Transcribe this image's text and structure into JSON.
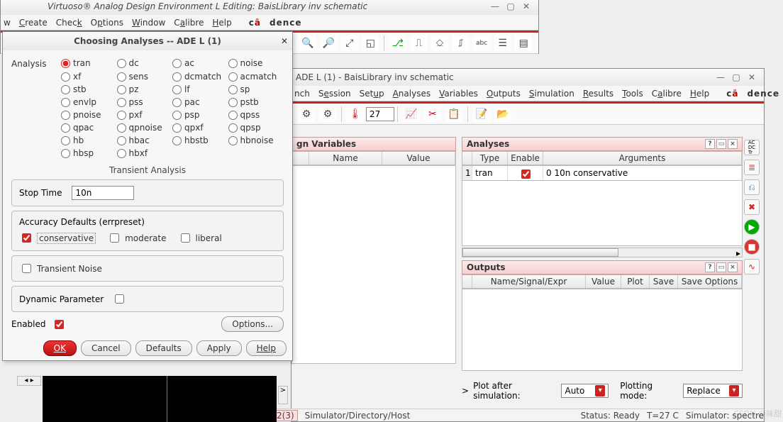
{
  "virtuoso": {
    "title": "Virtuoso® Analog Design Environment L Editing: BaisLibrary inv schematic",
    "menus": [
      "w",
      "Create",
      "Check",
      "Options",
      "Window",
      "Calibre",
      "Help"
    ],
    "brand": "cādence"
  },
  "top_toolbar_icons": [
    "zoom-in",
    "zoom-out",
    "zoom-fit",
    "zoom-select",
    "wire-add",
    "wire-1",
    "wire-2",
    "wire-3",
    "abc-label",
    "device",
    "form"
  ],
  "ade": {
    "title": "ADE L (1) - BaisLibrary inv schematic",
    "menus": [
      "nch",
      "Session",
      "Setup",
      "Analyses",
      "Variables",
      "Outputs",
      "Simulation",
      "Results",
      "Tools",
      "Calibre",
      "Help"
    ],
    "brand": "cādence",
    "temp_value": "27",
    "design_vars_title": "gn Variables",
    "dv_cols": [
      "Name",
      "Value"
    ],
    "analyses_title": "Analyses",
    "an_cols": [
      "Type",
      "Enable",
      "Arguments"
    ],
    "an_row": {
      "idx": "1",
      "type": "tran",
      "enable": true,
      "args": "0 10n conservative"
    },
    "outputs_title": "Outputs",
    "out_cols": [
      "Name/Signal/Expr",
      "Value",
      "Plot",
      "Save",
      "Save Options"
    ],
    "plot_after_label": "Plot after simulation:",
    "plot_after_value": "Auto",
    "plot_mode_label": "Plotting mode:",
    "plot_mode_value": "Replace",
    "status_bar": {
      "tabs": "2(3)",
      "label": "Simulator/Directory/Host",
      "status": "Status: Ready",
      "temp": "T=27 C",
      "sim": "Simulator: spectre"
    }
  },
  "dialog": {
    "title": "Choosing Analyses -- ADE L (1)",
    "analysis_label": "Analysis",
    "radios": [
      [
        "tran",
        "dc",
        "ac",
        "noise"
      ],
      [
        "xf",
        "sens",
        "dcmatch",
        "acmatch"
      ],
      [
        "stb",
        "pz",
        "lf",
        "sp"
      ],
      [
        "envlp",
        "pss",
        "pac",
        "pstb"
      ],
      [
        "pnoise",
        "pxf",
        "psp",
        "qpss"
      ],
      [
        "qpac",
        "qpnoise",
        "qpxf",
        "qpsp"
      ],
      [
        "hb",
        "hbac",
        "hbstb",
        "hbnoise"
      ],
      [
        "hbsp",
        "hbxf",
        "",
        ""
      ]
    ],
    "selected_radio": "tran",
    "section_title": "Transient Analysis",
    "stop_time_label": "Stop Time",
    "stop_time_value": "10n",
    "accuracy_label": "Accuracy Defaults (errpreset)",
    "acc_opts": [
      "conservative",
      "moderate",
      "liberal"
    ],
    "acc_selected": "conservative",
    "transient_noise_label": "Transient Noise",
    "dynamic_param_label": "Dynamic Parameter",
    "enabled_label": "Enabled",
    "enabled_checked": true,
    "options_btn": "Options...",
    "footer_btns": [
      "OK",
      "Cancel",
      "Defaults",
      "Apply",
      "Help"
    ]
  },
  "side_icons": [
    "ac-dc-trans",
    "props",
    "tree",
    "x-red",
    "play-green",
    "stop-red",
    "plot-wave"
  ],
  "watermark": "CSDN @味甜"
}
